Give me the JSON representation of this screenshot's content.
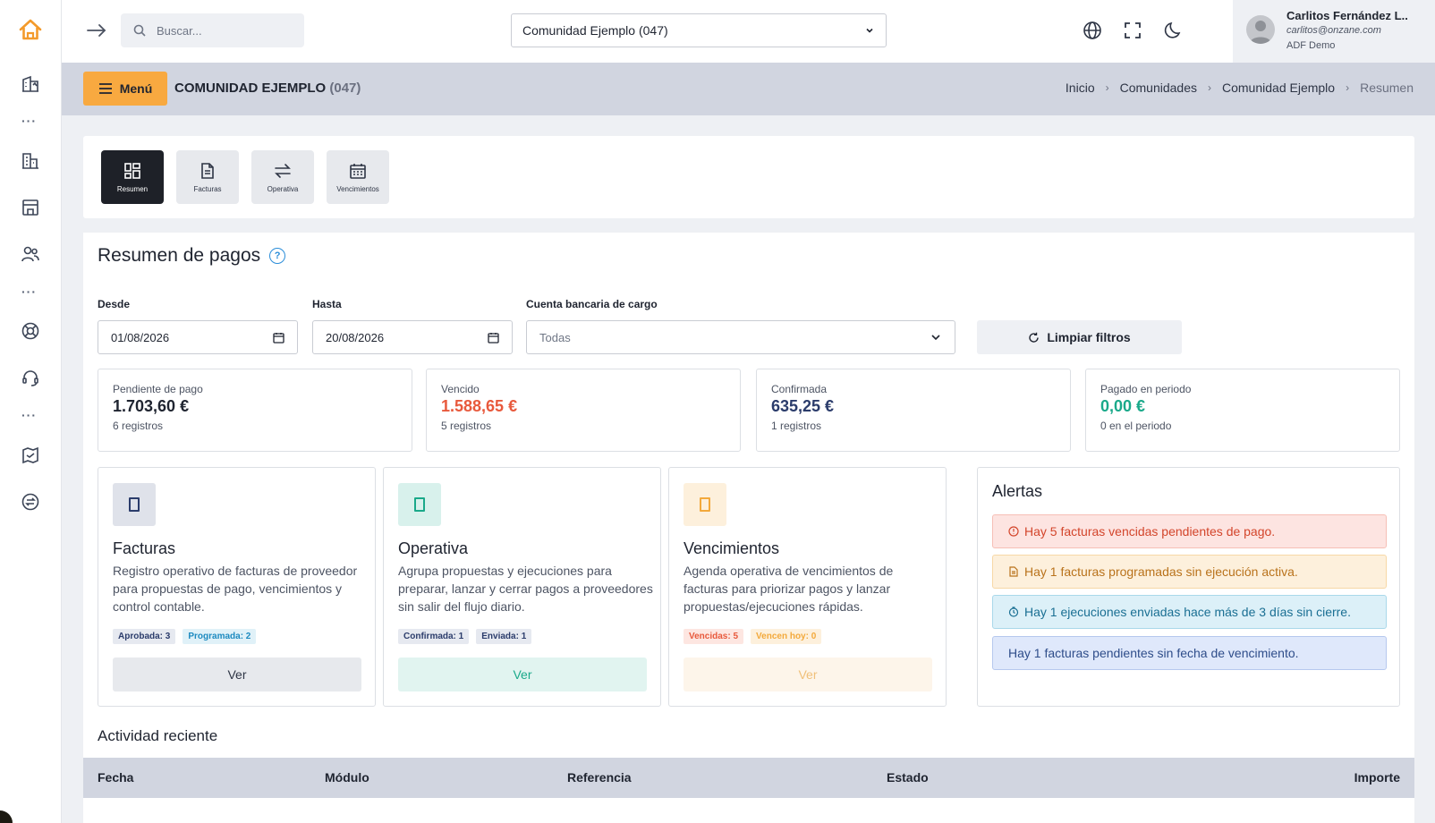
{
  "topbar": {
    "search_placeholder": "Buscar...",
    "community_selected": "Comunidad Ejemplo (047)",
    "user": {
      "name": "Carlitos Fernández L..",
      "email": "carlitos@onzane.com",
      "org": "ADF Demo"
    }
  },
  "sidebar": {
    "icons": [
      "home-icon",
      "building-chart-icon",
      "buildings-icon",
      "store-icon",
      "users-icon",
      "support-circle-icon",
      "headset-icon",
      "map-icon",
      "exchange-circle-icon"
    ]
  },
  "header": {
    "menu_label": "Menú",
    "title": "COMUNIDAD EJEMPLO",
    "code": "(047)",
    "breadcrumb": [
      "Inicio",
      "Comunidades",
      "Comunidad Ejemplo",
      "Resumen"
    ]
  },
  "tabs": [
    {
      "label": "Resumen",
      "icon": "dashboard-icon",
      "active": true
    },
    {
      "label": "Facturas",
      "icon": "document-icon",
      "active": false
    },
    {
      "label": "Operativa",
      "icon": "exchange-icon",
      "active": false
    },
    {
      "label": "Vencimientos",
      "icon": "calendar-icon",
      "active": false
    }
  ],
  "summary": {
    "title": "Resumen de pagos",
    "help_icon": "?",
    "filters": {
      "from_label": "Desde",
      "from_value": "01/08/2026",
      "to_label": "Hasta",
      "to_value": "20/08/2026",
      "account_label": "Cuenta bancaria de cargo",
      "account_value": "Todas",
      "clear_label": "Limpiar filtros"
    },
    "stats": [
      {
        "label": "Pendiente de pago",
        "value": "1.703,60 €",
        "sub": "6 registros",
        "color": "#1f2430"
      },
      {
        "label": "Vencido",
        "value": "1.588,65 €",
        "sub": "5 registros",
        "color": "#e8593c"
      },
      {
        "label": "Confirmada",
        "value": "635,25 €",
        "sub": "1 registros",
        "color": "#2b3c6b"
      },
      {
        "label": "Pagado en periodo",
        "value": "0,00 €",
        "sub": "0 en el periodo",
        "color": "#1aa98a"
      }
    ],
    "modules": [
      {
        "title": "Facturas",
        "desc": "Registro operativo de facturas de proveedor para propuestas de pago, vencimientos y control contable.",
        "badges": [
          "Aprobada: 3",
          "Programada: 2"
        ],
        "button": "Ver"
      },
      {
        "title": "Operativa",
        "desc": "Agrupa propuestas y ejecuciones para preparar, lanzar y cerrar pagos a proveedores sin salir del flujo diario.",
        "badges": [
          "Confirmada: 1",
          "Enviada: 1"
        ],
        "button": "Ver"
      },
      {
        "title": "Vencimientos",
        "desc": "Agenda operativa de vencimientos de facturas para priorizar pagos y lanzar propuestas/ejecuciones rápidas.",
        "badges": [
          "Vencidas: 5",
          "Vencen hoy: 0"
        ],
        "button": "Ver"
      }
    ],
    "alerts": {
      "title": "Alertas",
      "items": [
        "Hay 5 facturas vencidas pendientes de pago.",
        "Hay 1 facturas programadas sin ejecución activa.",
        "Hay 1 ejecuciones enviadas hace más de 3 días sin cierre.",
        "Hay 1 facturas pendientes sin fecha de vencimiento."
      ]
    },
    "recent": {
      "title": "Actividad reciente",
      "columns": [
        "Fecha",
        "Módulo",
        "Referencia",
        "Estado",
        "Importe"
      ]
    }
  }
}
